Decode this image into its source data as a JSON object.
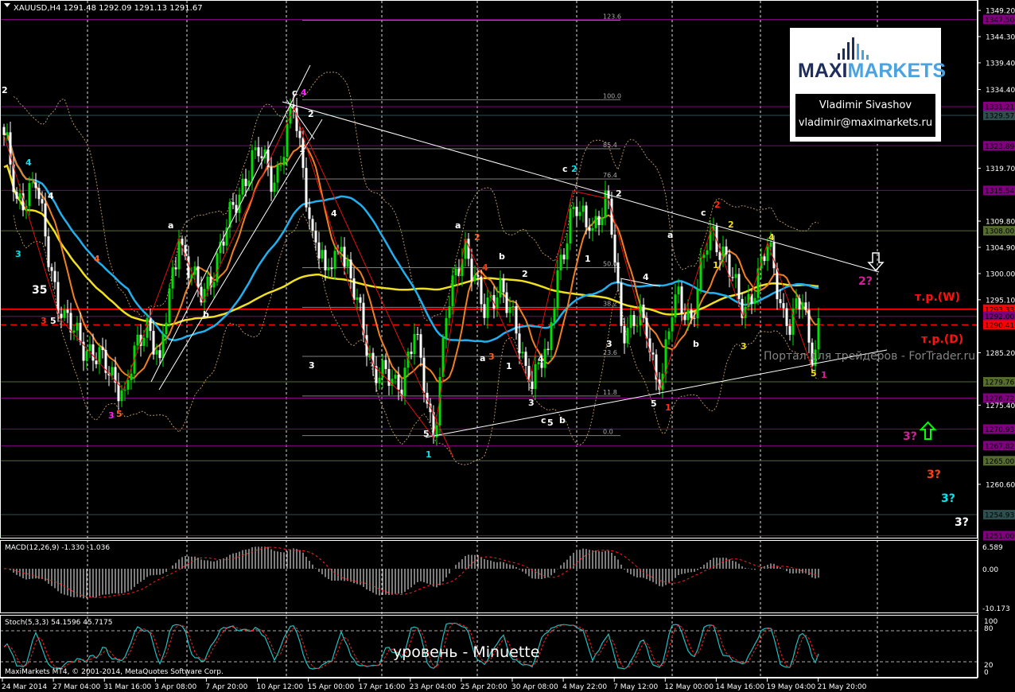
{
  "window": {
    "symbol_info": "XAUUSD,H4  1291.48 1292.09 1291.13 1291.67"
  },
  "logo": {
    "brand_left": "MAXI",
    "brand_right": "MARKETS",
    "author": "Vladimir Sivashov",
    "email": "vladimir@maximarkets.ru"
  },
  "watermark": "Портал для трейдеров - ForTrader.ru",
  "caption": "уровень - Minuette",
  "copyright": "MaxiMarkets MT4, © 2001-2014, MetaQuotes Software Corp.",
  "macd": {
    "title": "MACD(12,26,9) -1.330 -1.036",
    "scale": [
      "6.589",
      "0.00",
      "-10.173"
    ]
  },
  "stoch": {
    "title": "Stoch(5,3,3) 54.1596 45.7175",
    "scale": [
      "100",
      "80",
      "20",
      "0"
    ]
  },
  "chart_data": {
    "type": "candlestick",
    "symbol": "XAUUSD",
    "timeframe": "H4",
    "colors": {
      "bull": "#00e000",
      "bear": "#ffffff",
      "ma_long": "#f0e020",
      "ma_mid": "#20b0f0",
      "ma_short": "#f08020",
      "bands": "#b89060",
      "trend": "#ffffff",
      "zigzag": "#e01010",
      "fib": "#808080"
    },
    "price_ticks": [
      "1349.20",
      "1344.30",
      "1339.40",
      "1334.40",
      "1319.70",
      "1309.80",
      "1304.90",
      "1300.00",
      "1295.10",
      "1285.20",
      "1275.40",
      "1260.60"
    ],
    "levels": [
      {
        "price": 1347.5,
        "label": "1347.50",
        "color": "#800080",
        "style": "solid"
      },
      {
        "price": 1331.21,
        "label": "1331.21",
        "color": "#800080",
        "style": "solid"
      },
      {
        "price": 1329.57,
        "label": "1329.57",
        "color": "#2f4f4f",
        "style": "solid"
      },
      {
        "price": 1323.89,
        "label": "1323.89",
        "color": "#800080",
        "style": "solid"
      },
      {
        "price": 1315.54,
        "label": "1315.54",
        "color": "#800080",
        "style": "solid"
      },
      {
        "price": 1308.0,
        "label": "1308.00",
        "color": "#556b2f",
        "style": "solid"
      },
      {
        "price": 1293.33,
        "label": "1293.33",
        "color": "#ff0000",
        "style": "thick"
      },
      {
        "price": 1292.0,
        "label": "1292.00",
        "color": "#800080",
        "style": "solid"
      },
      {
        "price": 1290.41,
        "label": "1290.41",
        "color": "#ff0000",
        "style": "dashed"
      },
      {
        "price": 1279.76,
        "label": "1279.76",
        "color": "#556b2f",
        "style": "solid"
      },
      {
        "price": 1276.72,
        "label": "1276.72",
        "color": "#800080",
        "style": "solid"
      },
      {
        "price": 1270.93,
        "label": "1270.93",
        "color": "#800080",
        "style": "solid"
      },
      {
        "price": 1267.82,
        "label": "1267.82",
        "color": "#800080",
        "style": "solid"
      },
      {
        "price": 1265.0,
        "label": "1265.00",
        "color": "#556b2f",
        "style": "solid"
      },
      {
        "price": 1254.93,
        "label": "1254.93",
        "color": "#2f4f4f",
        "style": "solid"
      },
      {
        "price": 1251.0,
        "label": "1251.00",
        "color": "#800080",
        "style": "solid"
      }
    ],
    "swing_points": [
      [
        0,
        1325.9
      ],
      [
        4,
        1314
      ],
      [
        10,
        1316
      ],
      [
        18,
        1291.7
      ],
      [
        38,
        1278.3
      ],
      [
        45,
        1291.7
      ],
      [
        49,
        1284.2
      ],
      [
        55,
        1306.5
      ],
      [
        62,
        1294.6
      ],
      [
        79,
        1323.6
      ],
      [
        85,
        1317
      ],
      [
        91,
        1331
      ],
      [
        97,
        1308
      ],
      [
        101,
        1300.6
      ],
      [
        106,
        1305
      ],
      [
        116,
        1282.7
      ],
      [
        124,
        1278.3
      ],
      [
        129,
        1288.7
      ],
      [
        135,
        1269.4
      ],
      [
        139,
        1291.7
      ],
      [
        145,
        1306.5
      ],
      [
        151,
        1291.7
      ],
      [
        156,
        1299.1
      ],
      [
        165,
        1279.8
      ],
      [
        171,
        1285.7
      ],
      [
        174,
        1300.6
      ],
      [
        179,
        1312.5
      ],
      [
        184,
        1308
      ],
      [
        190,
        1314
      ],
      [
        194,
        1290.2
      ],
      [
        201,
        1291.7
      ],
      [
        206,
        1278.3
      ],
      [
        211,
        1296.1
      ],
      [
        216,
        1291.7
      ],
      [
        222,
        1308
      ],
      [
        227,
        1303.6
      ],
      [
        232,
        1291.7
      ],
      [
        240,
        1305
      ],
      [
        246,
        1290.2
      ],
      [
        251,
        1294.6
      ],
      [
        254,
        1282.7
      ],
      [
        256,
        1291.67
      ]
    ],
    "fibonacci": {
      "low": 1269.7,
      "high": 1332.5,
      "levels": [
        "123.6",
        "100.0",
        "85.4",
        "76.4",
        "50.0",
        "38.2",
        "23.6",
        "11.8",
        "0.0"
      ]
    },
    "wave_labels": [
      {
        "text": "2",
        "color": "#ffffff"
      },
      {
        "text": "4",
        "color": "#00e5ee"
      },
      {
        "text": "3",
        "color": "#00e5ee"
      },
      {
        "text": "4",
        "color": "#ffffff"
      },
      {
        "text": "4",
        "color": "#ff6020"
      },
      {
        "text": "35",
        "color": "#ffffff"
      },
      {
        "text": "3",
        "color": "#ff3010"
      },
      {
        "text": "5",
        "color": "#ffffff"
      },
      {
        "text": "a",
        "color": "#ffffff"
      },
      {
        "text": "b",
        "color": "#ffffff"
      },
      {
        "text": "3",
        "color": "#ff20ff"
      },
      {
        "text": "5",
        "color": "#ff6020"
      },
      {
        "text": "c",
        "color": "#ffffff"
      },
      {
        "text": "4",
        "color": "#ff20ff"
      },
      {
        "text": "2",
        "color": "#ffffff"
      },
      {
        "text": "1",
        "color": "#ffffff"
      },
      {
        "text": "4",
        "color": "#ffffff"
      },
      {
        "text": "3",
        "color": "#ffffff"
      },
      {
        "text": "a",
        "color": "#ffffff"
      },
      {
        "text": "2",
        "color": "#ff6020"
      },
      {
        "text": "4",
        "color": "#ff3010"
      },
      {
        "text": "b",
        "color": "#ffffff"
      },
      {
        "text": "2",
        "color": "#ffffff"
      },
      {
        "text": "1",
        "color": "#ffffff"
      },
      {
        "text": "a",
        "color": "#ffffff"
      },
      {
        "text": "3",
        "color": "#ff6020"
      },
      {
        "text": "4",
        "color": "#ffffff"
      },
      {
        "text": "3",
        "color": "#ffffff"
      },
      {
        "text": "c",
        "color": "#ffffff"
      },
      {
        "text": "5",
        "color": "#ffffff"
      },
      {
        "text": "b",
        "color": "#ffffff"
      },
      {
        "text": "5",
        "color": "#ffffff"
      },
      {
        "text": "1",
        "color": "#00e5ee"
      },
      {
        "text": "c",
        "color": "#ffffff"
      },
      {
        "text": "2",
        "color": "#00e5ee"
      },
      {
        "text": "2",
        "color": "#ffffff"
      },
      {
        "text": "1",
        "color": "#ffffff"
      },
      {
        "text": "4",
        "color": "#ffffff"
      },
      {
        "text": "3",
        "color": "#ffffff"
      },
      {
        "text": "5",
        "color": "#ffffff"
      },
      {
        "text": "1",
        "color": "#ff3010"
      },
      {
        "text": "a",
        "color": "#ffffff"
      },
      {
        "text": "b",
        "color": "#ffffff"
      },
      {
        "text": "c",
        "color": "#ffffff"
      },
      {
        "text": "2",
        "color": "#ff3010"
      },
      {
        "text": "2",
        "color": "#f0e020"
      },
      {
        "text": "1",
        "color": "#f0e020"
      },
      {
        "text": "4",
        "color": "#f0e020"
      },
      {
        "text": "3",
        "color": "#f0e020"
      },
      {
        "text": "5",
        "color": "#f0e020"
      },
      {
        "text": "1",
        "color": "#d0209a"
      },
      {
        "text": "2?",
        "color": "#d0209a"
      },
      {
        "text": "3?",
        "color": "#d0209a"
      },
      {
        "text": "3?",
        "color": "#ff4010"
      },
      {
        "text": "3?",
        "color": "#00e5ee"
      },
      {
        "text": "3?",
        "color": "#ffffff"
      },
      {
        "text": "т.р.(W)",
        "color": "#ff1010"
      },
      {
        "text": "т.р.(D)",
        "color": "#ff1010"
      }
    ],
    "time_labels": [
      "24 Mar 2014",
      "27 Mar 04:00",
      "31 Mar 16:00",
      "3 Apr 08:00",
      "7 Apr 20:00",
      "10 Apr 12:00",
      "15 Apr 00:00",
      "17 Apr 16:00",
      "23 Apr 04:00",
      "25 Apr 20:00",
      "30 Apr 08:00",
      "4 May 22:00",
      "7 May 12:00",
      "12 May 00:00",
      "14 May 16:00",
      "19 May 04:00",
      "21 May 20:00"
    ]
  }
}
